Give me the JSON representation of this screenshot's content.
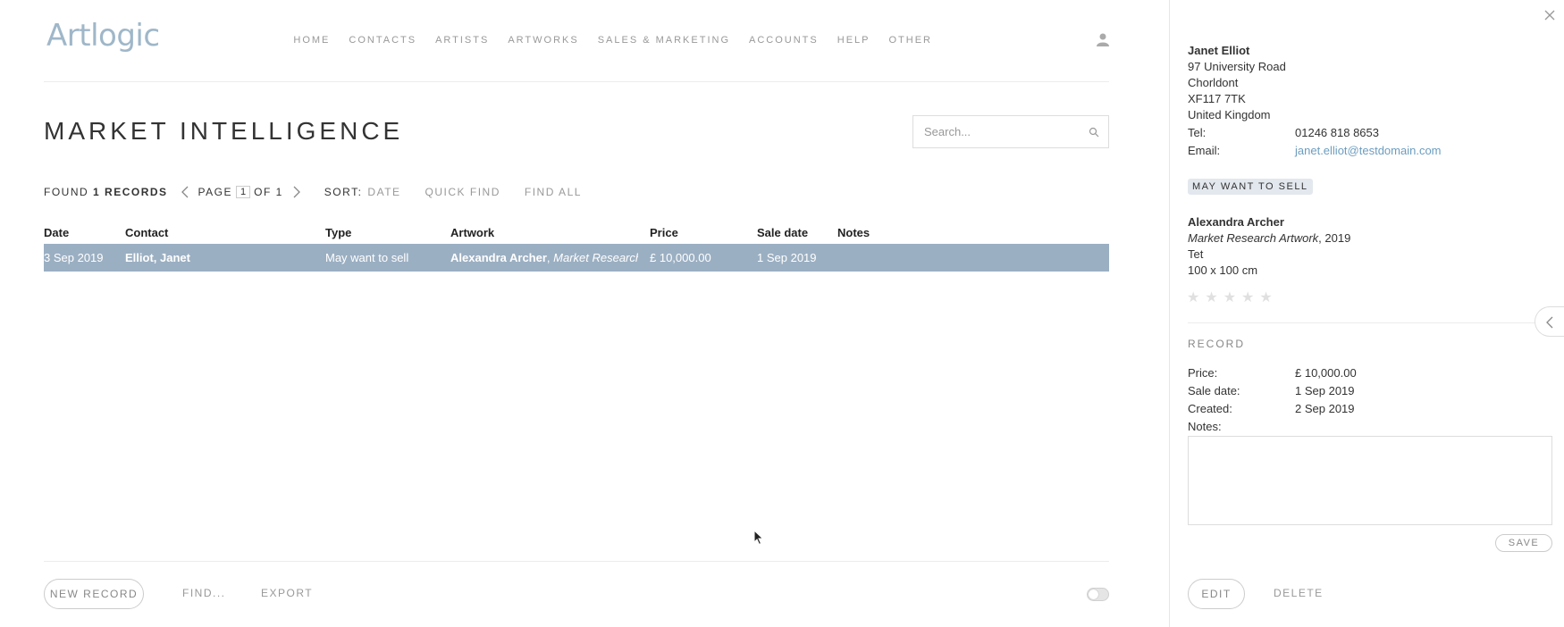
{
  "app": {
    "logo": "Artlogic"
  },
  "nav": {
    "items": [
      "HOME",
      "CONTACTS",
      "ARTISTS",
      "ARTWORKS",
      "SALES & MARKETING",
      "ACCOUNTS",
      "HELP",
      "OTHER"
    ],
    "user_icon": "user-icon"
  },
  "page": {
    "title": "MARKET INTELLIGENCE",
    "search_placeholder": "Search..."
  },
  "toolbar": {
    "found_prefix": "FOUND",
    "found_count": "1 RECORDS",
    "page_label": "PAGE",
    "page_value": "1",
    "of_label": "OF 1",
    "sort_label": "SORT:",
    "sort_value": "DATE",
    "quick_find": "QUICK FIND",
    "find_all": "FIND ALL"
  },
  "table": {
    "headers": [
      "Date",
      "Contact",
      "Type",
      "Artwork",
      "Price",
      "Sale date",
      "Notes"
    ],
    "rows": [
      {
        "date": "3 Sep 2019",
        "contact": "Elliot, Janet",
        "type": "May want to sell",
        "artwork_artist": "Alexandra Archer",
        "artwork_title": "Market Research...",
        "price": "£ 10,000.00",
        "sale_date": "1 Sep 2019",
        "notes": ""
      }
    ]
  },
  "footer": {
    "new_record": "NEW RECORD",
    "find": "FIND...",
    "export": "EXPORT"
  },
  "detail": {
    "contact": {
      "name": "Janet Elliot",
      "address": [
        "97 University Road",
        "Chorldont",
        "XF117 7TK",
        "United Kingdom"
      ],
      "tel_label": "Tel:",
      "tel": "01246 818 8653",
      "email_label": "Email:",
      "email": "janet.elliot@testdomain.com"
    },
    "badge": "MAY WANT TO SELL",
    "artwork": {
      "artist": "Alexandra Archer",
      "title": "Market Research Artwork",
      "year": ", 2019",
      "medium": "Tet",
      "dimensions": "100 x 100 cm",
      "rating": 0,
      "rating_max": 5
    },
    "record": {
      "heading": "RECORD",
      "price_label": "Price:",
      "price": "£ 10,000.00",
      "sale_date_label": "Sale date:",
      "sale_date": "1 Sep 2019",
      "created_label": "Created:",
      "created": "2 Sep 2019",
      "notes_label": "Notes:",
      "notes": ""
    },
    "save": "SAVE",
    "edit": "EDIT",
    "delete": "DELETE"
  },
  "colors": {
    "accent": "#9bafc2",
    "logo": "#9fb7c9",
    "link": "#6c9dbf",
    "badge_bg": "#e3e8ee"
  }
}
